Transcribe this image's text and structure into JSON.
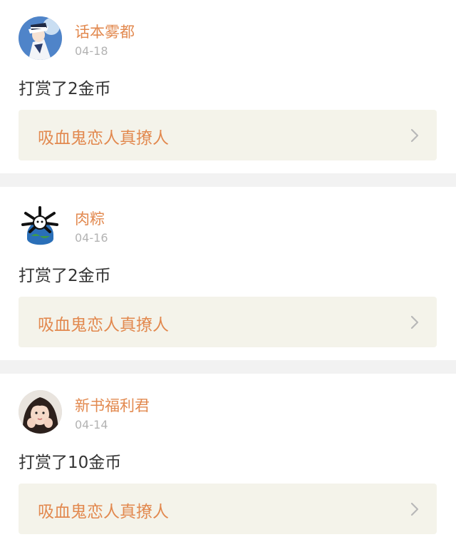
{
  "feed": {
    "items": [
      {
        "user_name": "话本雾都",
        "date": "04-18",
        "message": "打赏了2金币",
        "book_title": "吸血鬼恋人真撩人",
        "avatar_icon": "anime-character-avatar"
      },
      {
        "user_name": "肉粽",
        "date": "04-16",
        "message": "打赏了2金币",
        "book_title": "吸血鬼恋人真撩人",
        "avatar_icon": "cartoon-globe-avatar"
      },
      {
        "user_name": "新书福利君",
        "date": "04-14",
        "message": "打赏了10金币",
        "book_title": "吸血鬼恋人真撩人",
        "avatar_icon": "girl-photo-avatar"
      }
    ]
  },
  "colors": {
    "accent": "#e2894f",
    "date_gray": "#b3b3b3",
    "text_dark": "#333333",
    "book_bg": "#f4f3ea",
    "divider_bg": "#f2f2f2"
  }
}
